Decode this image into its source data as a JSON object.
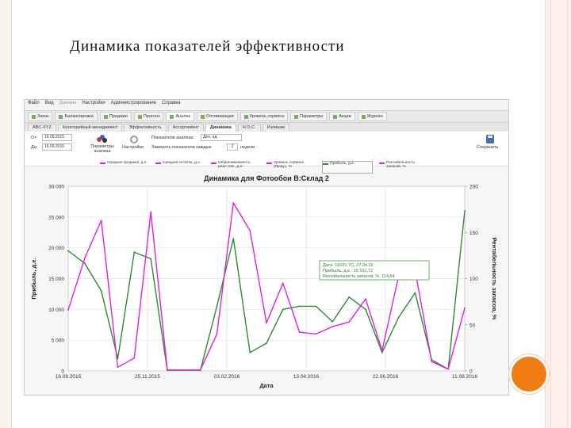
{
  "slide": {
    "title": "Динамика показателей эффективности"
  },
  "app": {
    "menu": [
      "Файл",
      "Вид",
      "Данные",
      "Настройки",
      "Администрирование",
      "Справка"
    ],
    "toolbar": [
      "Заказ",
      "Балансировка",
      "Продажи",
      "Прогноз",
      "Анализ",
      "Оптимизация",
      "Уровень сервиса",
      "Параметры",
      "Акции",
      "Журнал"
    ],
    "toolbar_active": "Анализ",
    "tabs": [
      "ABC-XYZ",
      "Категорийный менеджмент",
      "Эффективность",
      "Ассортимент",
      "Динамика",
      "Н.О.С.",
      "Излишки"
    ],
    "tab_active": "Динамика",
    "controls": {
      "from_label": "От:",
      "from_date": "16.09.2015",
      "to_label": "До:",
      "to_date": "16.09.2016",
      "params_label": "Параметры анализа",
      "settings_label": "Настройки",
      "show_values_label": "Показатели анализа:",
      "show_values_select": "Ден. ед.",
      "measure_label": "Замерять показатели каждые",
      "measure_value": "2",
      "measure_unit": "недели",
      "save_label": "Сохранить"
    },
    "legend": [
      {
        "label": "Средние продажи, д.е.",
        "color": "#e020e0"
      },
      {
        "label": "Средний остаток, д.е.",
        "color": "#e020e0"
      },
      {
        "label": "Оборачиваемость реал.тов., д.е.",
        "color": "#e020e0"
      },
      {
        "label": "Уровень сервиса (Прод.), %",
        "color": "#e020e0"
      },
      {
        "label": "Прибыль, д.е.",
        "color": "#2e8b2e"
      },
      {
        "label": "Рентабельность запасов, %",
        "color": "#e020e0"
      }
    ]
  },
  "tooltip": {
    "line1": "Дата: 16031.7С, 27.04.16",
    "line2": "Прибыль, д.е.: 16 531,72",
    "line3": "Рентабельность запасов, %: 114,54"
  },
  "chart_data": {
    "type": "line",
    "title": "Динамика для Фотообои В:Склад 2",
    "xlabel": "Дата",
    "ylabel": "Прибыль, д.е.",
    "y2label": "Рентабельность запасов, %",
    "x_ticks": [
      "16.09.2015",
      "25.11.2015",
      "03.02.2016",
      "13.04.2016",
      "22.06.2016",
      "11.08.2016"
    ],
    "y_ticks": [
      "0",
      "5 000",
      "10 000",
      "15 000",
      "20 000",
      "25 000",
      "30 000"
    ],
    "y2_ticks": [
      "0",
      "50",
      "100",
      "150",
      "200"
    ],
    "ylim": [
      0,
      30000
    ],
    "y2lim": [
      0,
      200
    ],
    "grid": true,
    "legend_position": "top",
    "x_index_range": [
      0,
      24
    ],
    "series": [
      {
        "name": "Прибыль, д.е.",
        "color": "#2e8b2e",
        "axis": "left",
        "x": [
          0,
          1,
          2,
          3,
          4,
          5,
          6,
          7,
          8,
          9,
          10,
          11,
          12,
          13,
          14,
          15,
          16,
          17,
          18,
          19,
          20,
          21,
          22,
          23,
          24
        ],
        "values": [
          19500,
          17500,
          13000,
          2000,
          19300,
          18200,
          100,
          100,
          100,
          10500,
          21500,
          3000,
          4500,
          10000,
          10500,
          10500,
          8000,
          12000,
          10000,
          3000,
          8700,
          12700,
          1800,
          300,
          26000
        ]
      },
      {
        "name": "Рентабельность запасов, %",
        "color": "#e020e0",
        "axis": "right",
        "x": [
          0,
          1,
          2,
          3,
          4,
          5,
          6,
          7,
          8,
          9,
          10,
          11,
          12,
          13,
          14,
          15,
          16,
          17,
          18,
          19,
          20,
          21,
          22,
          23,
          24
        ],
        "values": [
          66,
          122,
          163,
          4,
          14,
          172,
          1,
          1,
          1,
          40,
          182,
          152,
          52,
          95,
          42,
          40,
          48,
          53,
          78,
          22,
          103,
          109,
          10,
          2,
          68
        ]
      }
    ]
  }
}
